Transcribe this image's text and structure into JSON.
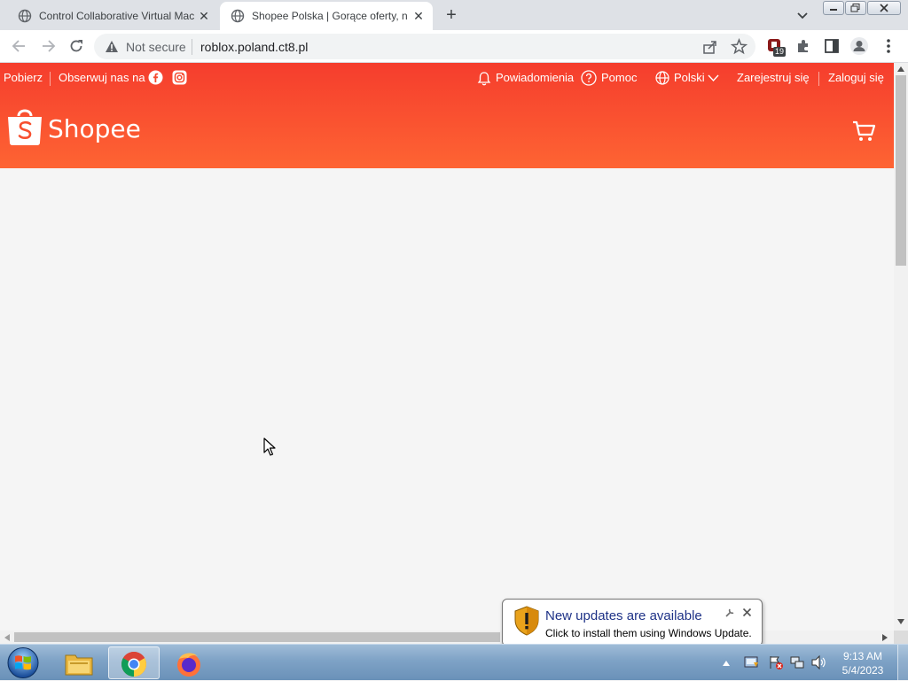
{
  "tabs": [
    {
      "title": "Control Collaborative Virtual Mac",
      "active": false
    },
    {
      "title": "Shopee Polska | Gorące oferty, n",
      "active": true
    }
  ],
  "new_tab_label": "+",
  "address_bar": {
    "security_label": "Not secure",
    "url": "roblox.poland.ct8.pl",
    "extension_badge": "19"
  },
  "shopee": {
    "topbar_left": {
      "download": "Pobierz",
      "follow": "Obserwuj nas na"
    },
    "topbar_right": {
      "notifications": "Powiadomienia",
      "help": "Pomoc",
      "language": "Polski",
      "register": "Zarejestruj się",
      "login": "Zaloguj się"
    },
    "logo_text": "Shopee",
    "colors": {
      "brand_top": "#f53d2d",
      "brand_bottom": "#fe6433",
      "background": "#f5f5f5"
    }
  },
  "notification_balloon": {
    "title": "New updates are available",
    "text": "Click to install them using Windows Update."
  },
  "taskbar": {
    "time": "9:13 AM",
    "date": "5/4/2023",
    "apps": [
      "windows-start",
      "file-explorer",
      "google-chrome",
      "firefox"
    ]
  }
}
